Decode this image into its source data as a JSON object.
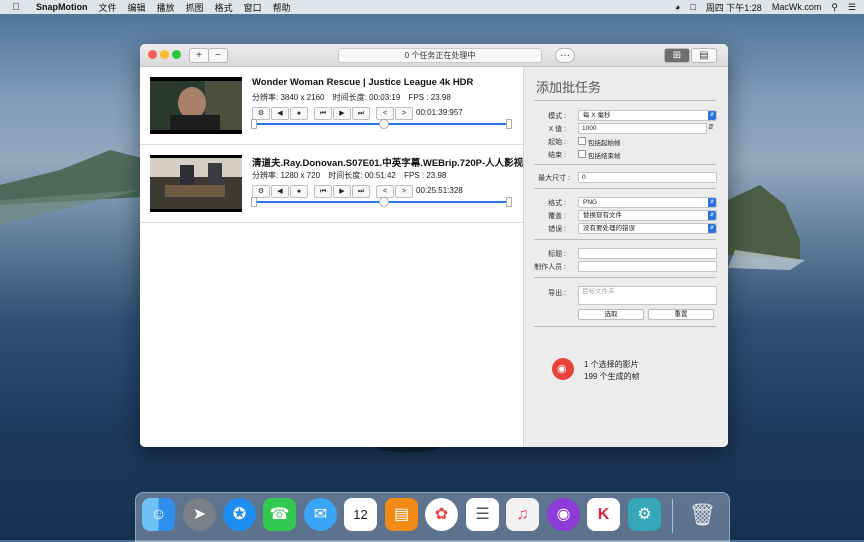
{
  "menubar": {
    "app_name": "SnapMotion",
    "items": [
      "文件",
      "编辑",
      "播放",
      "抓图",
      "格式",
      "窗口",
      "帮助"
    ],
    "clock": "周四 下午1:28",
    "site": "MacWk.com"
  },
  "toolbar": {
    "add_label": "+",
    "remove_label": "−",
    "status_text": "0 个任务正在处理中",
    "more_label": "···"
  },
  "videos": [
    {
      "title": "Wonder Woman Rescue | Justice League 4k HDR",
      "resolution": "分辨率:  3840 x 2160",
      "duration": "时间长度:  00:03:19",
      "fps": "FPS : 23.98",
      "timecode": "00:01:39:957",
      "position": 0.5
    },
    {
      "title": "清道夫.Ray.Donovan.S07E01.中英字幕.WEBrip.720P-人人影视",
      "resolution": "分辨率:  1280 x 720",
      "duration": "时间长度:  00:51:42",
      "fps": "FPS : 23.98",
      "timecode": "00:25:51:328",
      "position": 0.5
    }
  ],
  "batch": {
    "title": "添加批任务",
    "mode_label": "模式 :",
    "mode_value": "每 X 毫秒",
    "x_label": "X 值 :",
    "x_value": "1000",
    "start_label": "起始 :",
    "start_check": "包括起始帧",
    "end_label": "结束 :",
    "end_check": "包括结束帧",
    "maxsize_label": "最大尺寸 :",
    "maxsize_value": "0",
    "format_label": "格式 :",
    "format_value": "PNG",
    "overwrite_label": "覆盖 :",
    "overwrite_value": "替换现有文件",
    "error_label": "错误 :",
    "error_value": "没有要处理的错误",
    "titlefield_label": "标题 :",
    "author_label": "制作人员 :",
    "export_label": "导出 :",
    "export_placeholder": "目标文件夹",
    "choose_button": "选取",
    "reset_button": "重置",
    "selected_count": "1 个选择的影片",
    "frames_count": "199 个生成的帧"
  }
}
